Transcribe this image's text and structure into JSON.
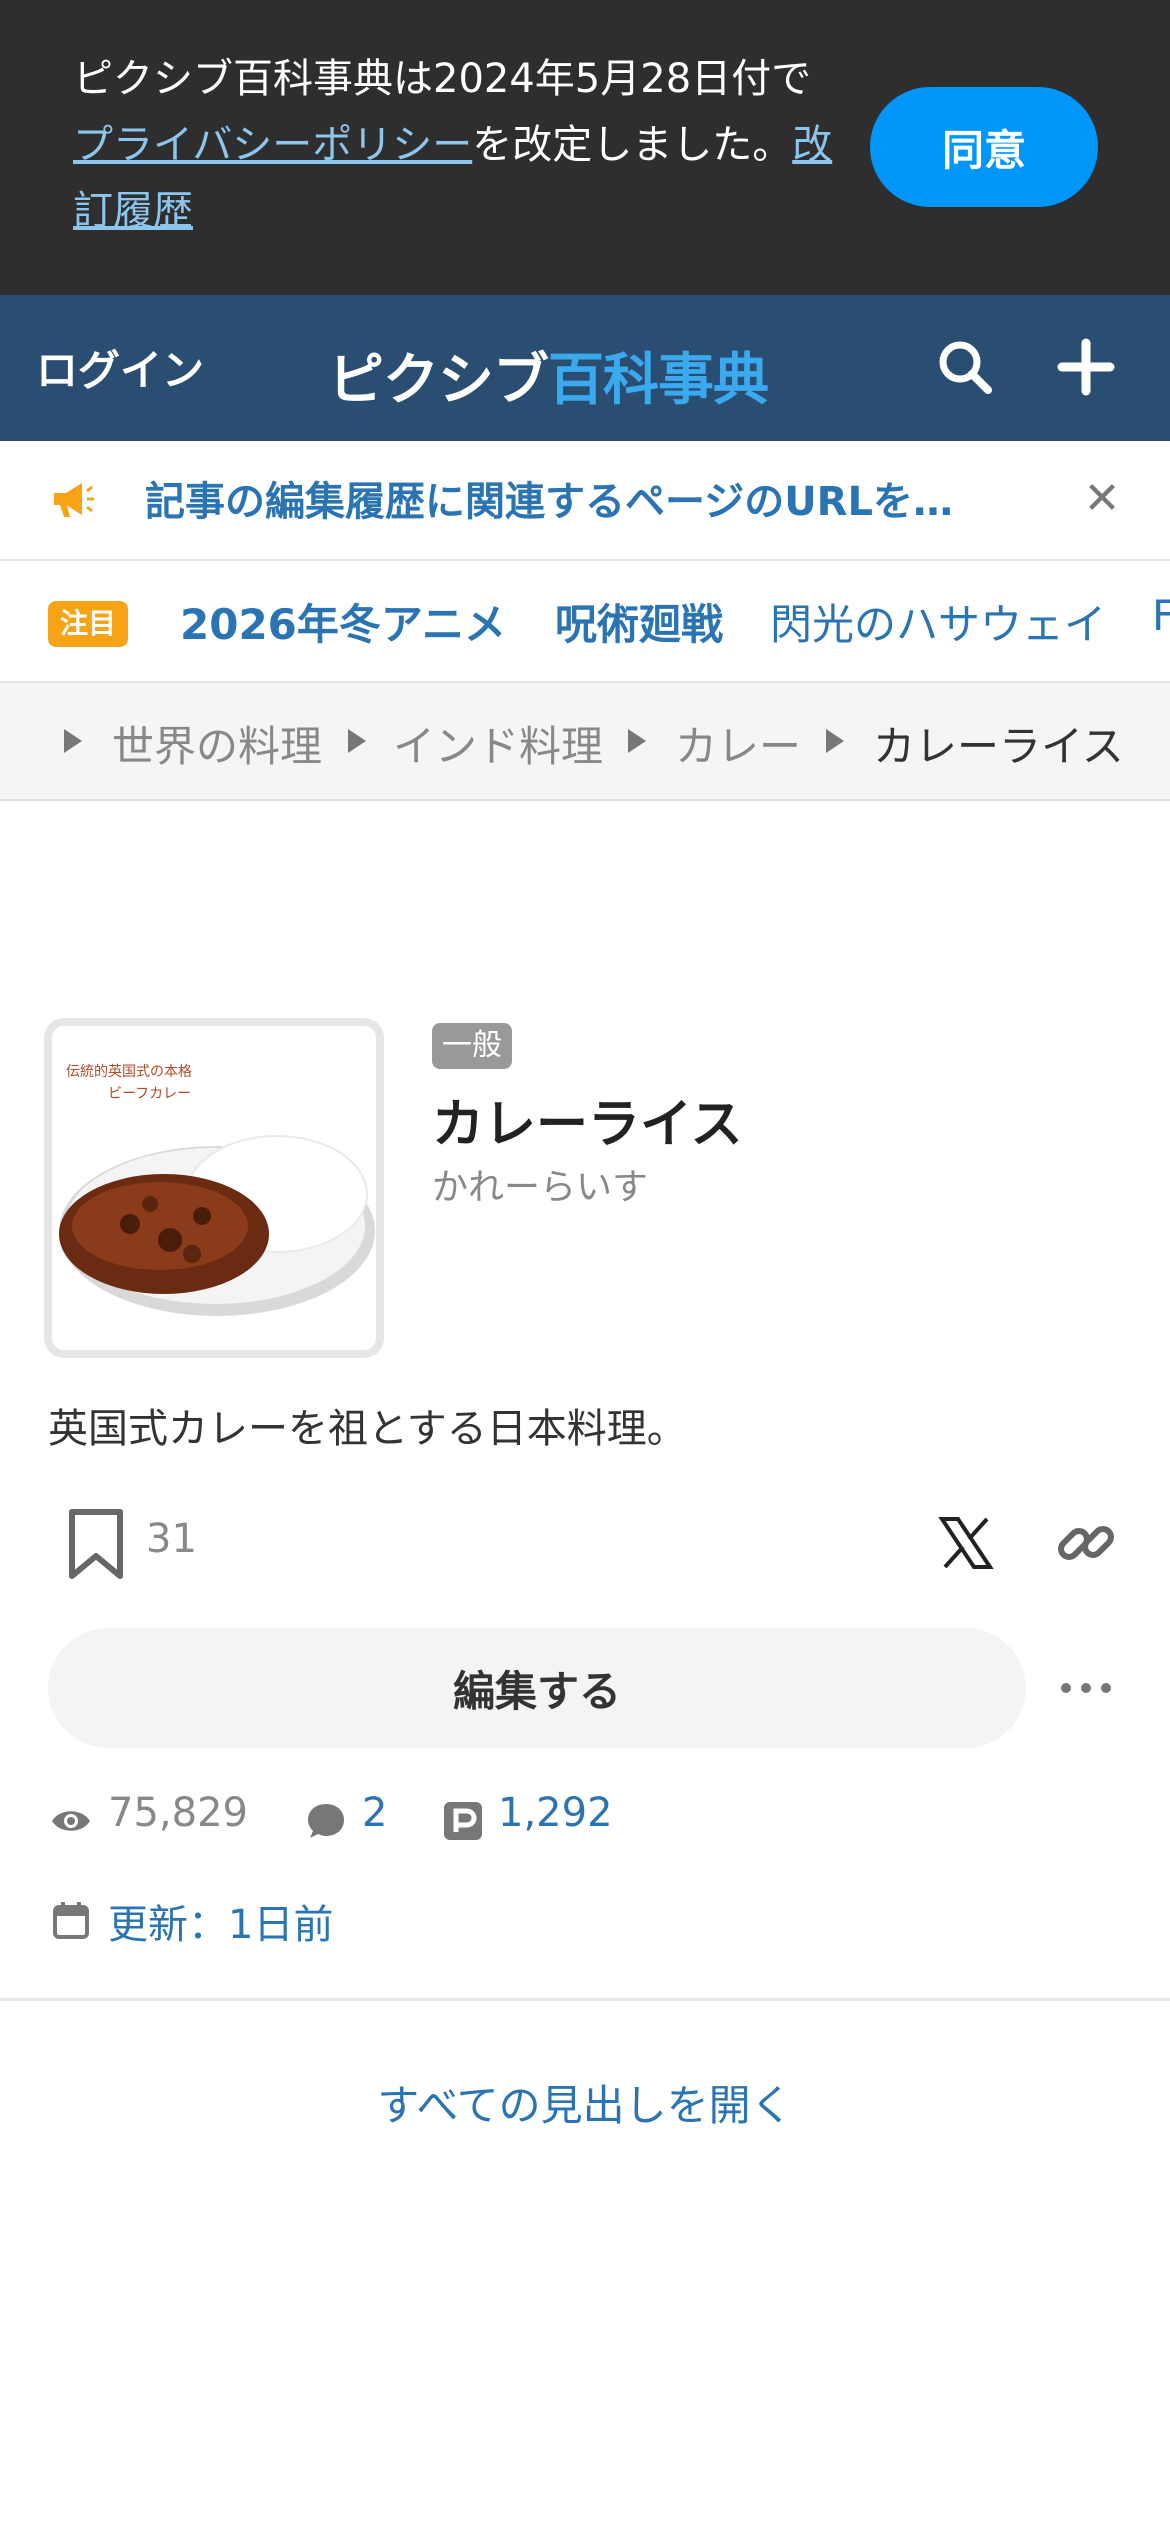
{
  "consent": {
    "text_before": "ピクシブ百科事典は2024年5月28日付で",
    "policy_link": "プライバシーポリシー",
    "text_middle": "を改定しました。",
    "history_link": "改訂履歴",
    "agree_label": "同意"
  },
  "header": {
    "login_label": "ログイン",
    "logo_part1": "ピクシブ",
    "logo_part2": "百科事典"
  },
  "notice": {
    "text": "記事の編集履歴に関連するページのURLを…",
    "accent": "#f6a415"
  },
  "trending": {
    "badge": "注目",
    "items": [
      "2026年冬アニメ",
      "呪術廻戦",
      "閃光のハサウェイ",
      "F"
    ]
  },
  "breadcrumb": [
    "世界の料理",
    "インド料理",
    "カレー",
    "カレーライス"
  ],
  "article": {
    "category": "一般",
    "title": "カレーライス",
    "reading": "かれーらいす",
    "summary": "英国式カレーを祖とする日本料理。",
    "thumb_caption_1": "伝統的英国式の本格",
    "thumb_caption_2": "ビーフカレー",
    "bookmark_count": "31",
    "edit_label": "編集する",
    "views": "75,829",
    "comments": "2",
    "pixiv_count": "1,292",
    "updated": "更新：1日前"
  },
  "toc": {
    "expand_label": "すべての見出しを開く"
  },
  "colors": {
    "header_bg": "#2a4e72",
    "link": "#2a74b3",
    "agree_button": "#0096fa"
  }
}
